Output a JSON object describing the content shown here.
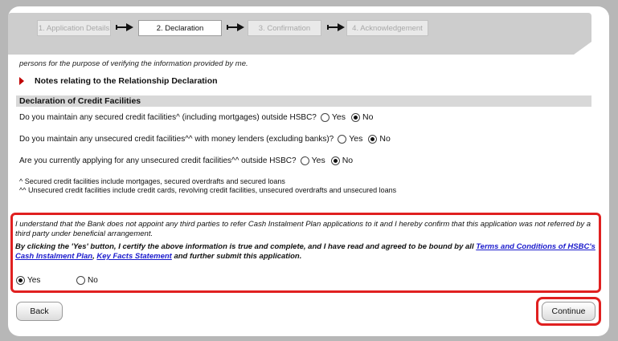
{
  "steps": [
    {
      "label": "1. Application Details",
      "active": false
    },
    {
      "label": "2. Declaration",
      "active": true
    },
    {
      "label": "3. Confirmation",
      "active": false
    },
    {
      "label": "4. Acknowledgement",
      "active": false
    }
  ],
  "cut_text": "persons for the purpose of verifying the information provided by me.",
  "notes_link": "Notes relating to the Relationship Declaration",
  "section_title": "Declaration of Credit Facilities",
  "questions": [
    {
      "text": "Do you maintain any secured credit facilities^ (including mortgages) outside HSBC?",
      "yes_label": "Yes",
      "no_label": "No",
      "selected": "No"
    },
    {
      "text": "Do you maintain any unsecured credit facilities^^ with money lenders (excluding banks)?",
      "yes_label": "Yes",
      "no_label": "No",
      "selected": "No"
    },
    {
      "text": "Are you currently applying for any unsecured credit facilities^^ outside HSBC?",
      "yes_label": "Yes",
      "no_label": "No",
      "selected": "No"
    }
  ],
  "footnotes": [
    "^ Secured credit facilities include mortgages, secured overdrafts and secured loans",
    "^^ Unsecured credit facilities include credit cards, revolving credit facilities, unsecured overdrafts and unsecured loans"
  ],
  "declaration": {
    "italic_text": "I understand that the Bank does not appoint any third parties to refer Cash Instalment Plan applications to it and I hereby confirm that this application was not referred by a third party under beneficial arrangement.",
    "bold_prefix": "By clicking the 'Yes' button, I certify the above information is true and complete, and I have read and agreed to be bound by all",
    "link_terms": "Terms and Conditions of HSBC's Cash Instalment Plan",
    "separator": ",",
    "link_kfs": "Key Facts Statement",
    "bold_suffix": "and further submit this application.",
    "yes_label": "Yes",
    "no_label": "No",
    "selected": "Yes"
  },
  "buttons": {
    "back": "Back",
    "continue": "Continue"
  },
  "colors": {
    "highlight": "#e02020",
    "link": "#1a1acc",
    "bullet": "#c00000"
  }
}
